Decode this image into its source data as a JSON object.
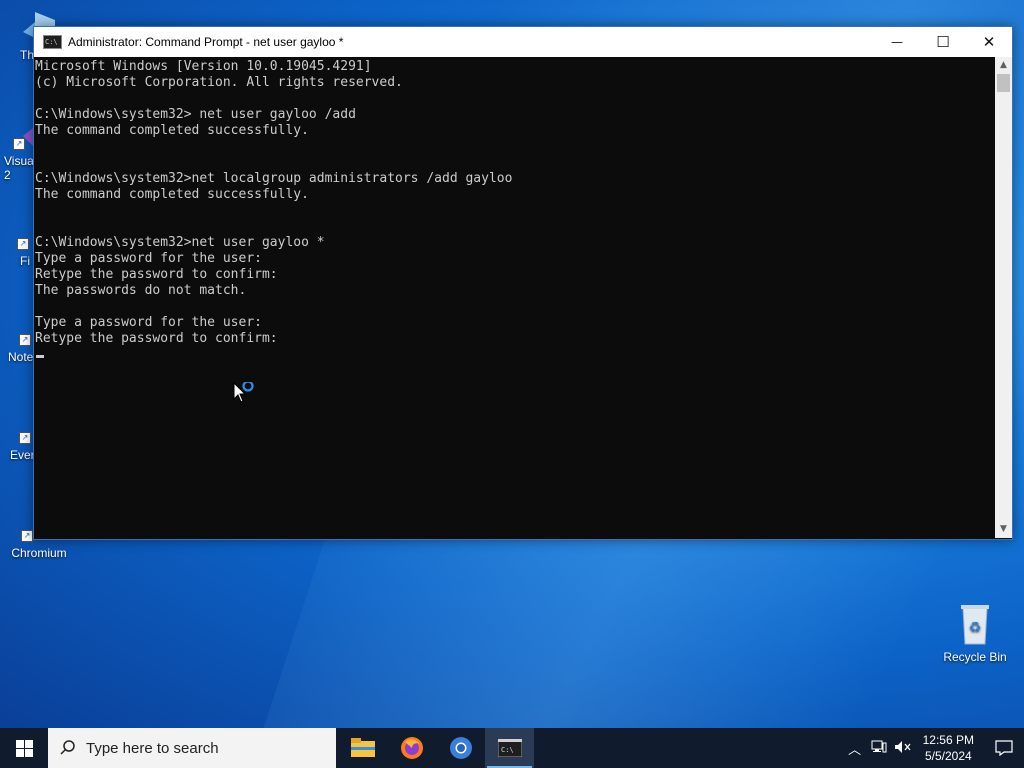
{
  "window": {
    "title": "Administrator: Command Prompt - net  user gayloo *",
    "minimize_glyph": "—",
    "maximize_glyph": "☐",
    "close_glyph": "✕"
  },
  "console": {
    "lines": [
      "Microsoft Windows [Version 10.0.19045.4291]",
      "(c) Microsoft Corporation. All rights reserved.",
      "",
      "C:\\Windows\\system32> net user gayloo /add",
      "The command completed successfully.",
      "",
      "",
      "C:\\Windows\\system32>net localgroup administrators /add gayloo",
      "The command completed successfully.",
      "",
      "",
      "C:\\Windows\\system32>net user gayloo *",
      "Type a password for the user:",
      "Retype the password to confirm:",
      "The passwords do not match.",
      "",
      "Type a password for the user:",
      "Retype the password to confirm:"
    ]
  },
  "desktop": {
    "icons": [
      {
        "name": "Th",
        "icon": "folder-icon"
      },
      {
        "name": "Visua\n2",
        "icon": "visual-studio-icon"
      },
      {
        "name": "Fi",
        "icon": "firefox-icon"
      },
      {
        "name": "Note",
        "icon": "notepad-icon"
      },
      {
        "name": "Ever",
        "icon": "everything-icon"
      },
      {
        "name": "Chromium",
        "icon": "chromium-icon"
      }
    ],
    "recycle_bin_label": "Recycle Bin"
  },
  "taskbar": {
    "search_placeholder": "Type here to search",
    "apps": [
      "file-explorer-icon",
      "firefox-icon",
      "chromium-icon",
      "command-prompt-icon"
    ],
    "time": "12:56 PM",
    "date": "5/5/2024"
  },
  "colors": {
    "console_bg": "#0c0c0c",
    "console_text": "#cccccc",
    "taskbar_bg": "#101b2d",
    "accent": "#76b9ed"
  }
}
